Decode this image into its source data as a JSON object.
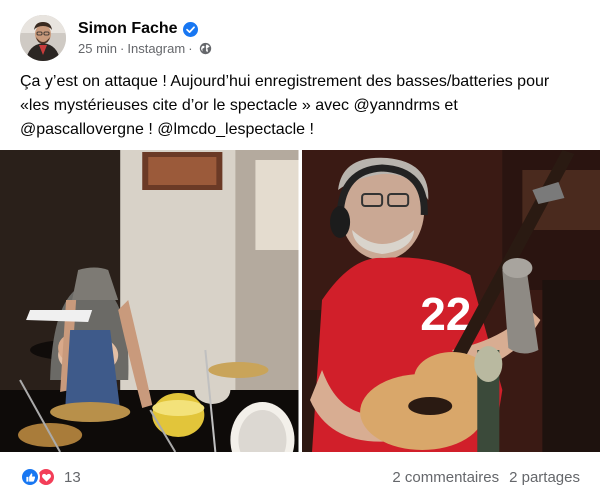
{
  "post": {
    "author": "Simon Fache",
    "time": "25 min",
    "source": "Instagram",
    "separator": "·",
    "text": "Ça y’est on attaque ! Aujourd’hui enregistrement des basses/batteries pour «les mystérieuses cite d’or le spectacle » avec @yanndrms et @pascallovergne ! @lmcdo_lespectacle !"
  },
  "icons": {
    "verified": "verified-badge-icon",
    "audience": "globe-icon",
    "like": "like-reaction-icon",
    "love": "love-reaction-icon"
  },
  "footer": {
    "reaction_count": "13",
    "comments": "2 commentaires",
    "shares": "2 partages"
  },
  "colors": {
    "brand": "#1877f2",
    "love": "#f33e58",
    "secondary_text": "#65676b"
  }
}
